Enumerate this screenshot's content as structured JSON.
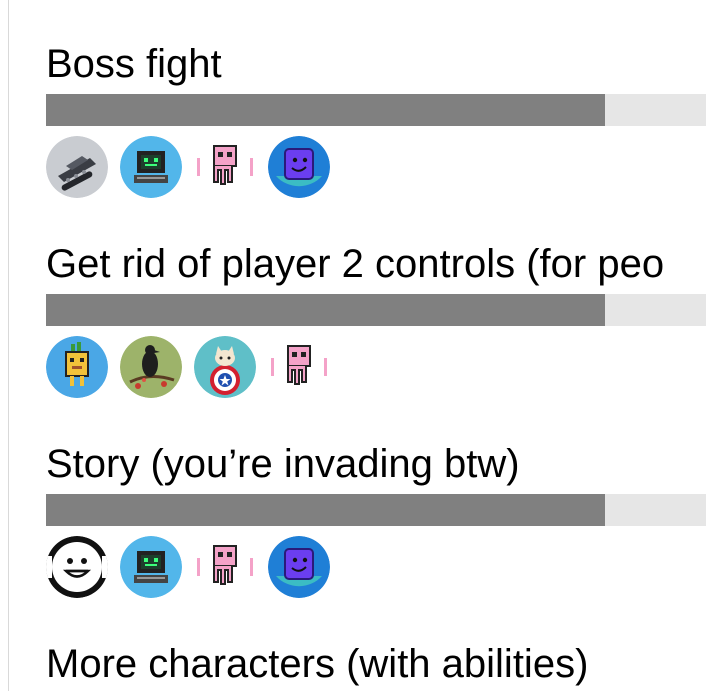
{
  "poll": {
    "items": [
      {
        "title": "Boss fight",
        "progress": 0.847,
        "voters": [
          "tank-avatar",
          "computer-avatar",
          "pink-octopus-avatar",
          "purple-smile-avatar"
        ]
      },
      {
        "title": "Get rid of player 2 controls (for peo",
        "progress": 0.847,
        "voters": [
          "pixel-pineapple-avatar",
          "bird-avatar",
          "cat-shield-avatar",
          "pink-octopus-avatar"
        ]
      },
      {
        "title": "Story (you’re invading btw)",
        "progress": 0.847,
        "voters": [
          "smiley-avatar",
          "computer-avatar",
          "pink-octopus-avatar",
          "purple-smile-avatar"
        ]
      },
      {
        "title": "More characters (with abilities)",
        "progress": null,
        "voters": []
      }
    ]
  },
  "colors": {
    "bar_fill": "#808080",
    "bar_track": "#e6e6e6",
    "text": "#000000"
  }
}
